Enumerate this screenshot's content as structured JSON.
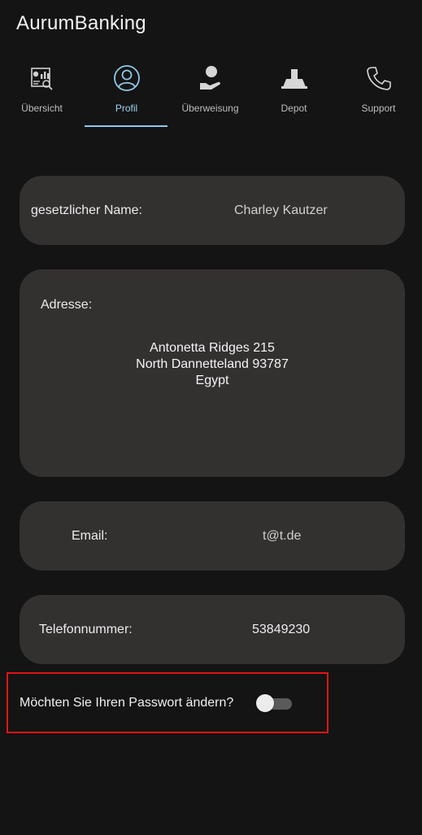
{
  "app": {
    "title": "AurumBanking"
  },
  "tabs": [
    {
      "label": "Übersicht",
      "icon": "dashboard-report-icon",
      "active": false
    },
    {
      "label": "Profil",
      "icon": "user-profile-icon",
      "active": true
    },
    {
      "label": "Überweisung",
      "icon": "transfer-hand-icon",
      "active": false
    },
    {
      "label": "Depot",
      "icon": "depot-icon",
      "active": false
    },
    {
      "label": "Support",
      "icon": "phone-icon",
      "active": false
    }
  ],
  "profile": {
    "name": {
      "label": "gesetzlicher Name:",
      "value": "Charley Kautzer"
    },
    "address": {
      "label": "Adresse:",
      "line1": "Antonetta Ridges 215",
      "line2": "North Dannetteland 93787",
      "line3": "Egypt"
    },
    "email": {
      "label": "Email:",
      "value": "t@t.de"
    },
    "phone": {
      "label": "Telefonnummer:",
      "value": "53849230"
    }
  },
  "password": {
    "prompt": "Möchten Sie Ihren Passwort ändern?",
    "toggle_on": false
  },
  "colors": {
    "accent": "#8ec9e8",
    "card": "#333030",
    "background": "#141414",
    "highlight": "#e01515"
  }
}
